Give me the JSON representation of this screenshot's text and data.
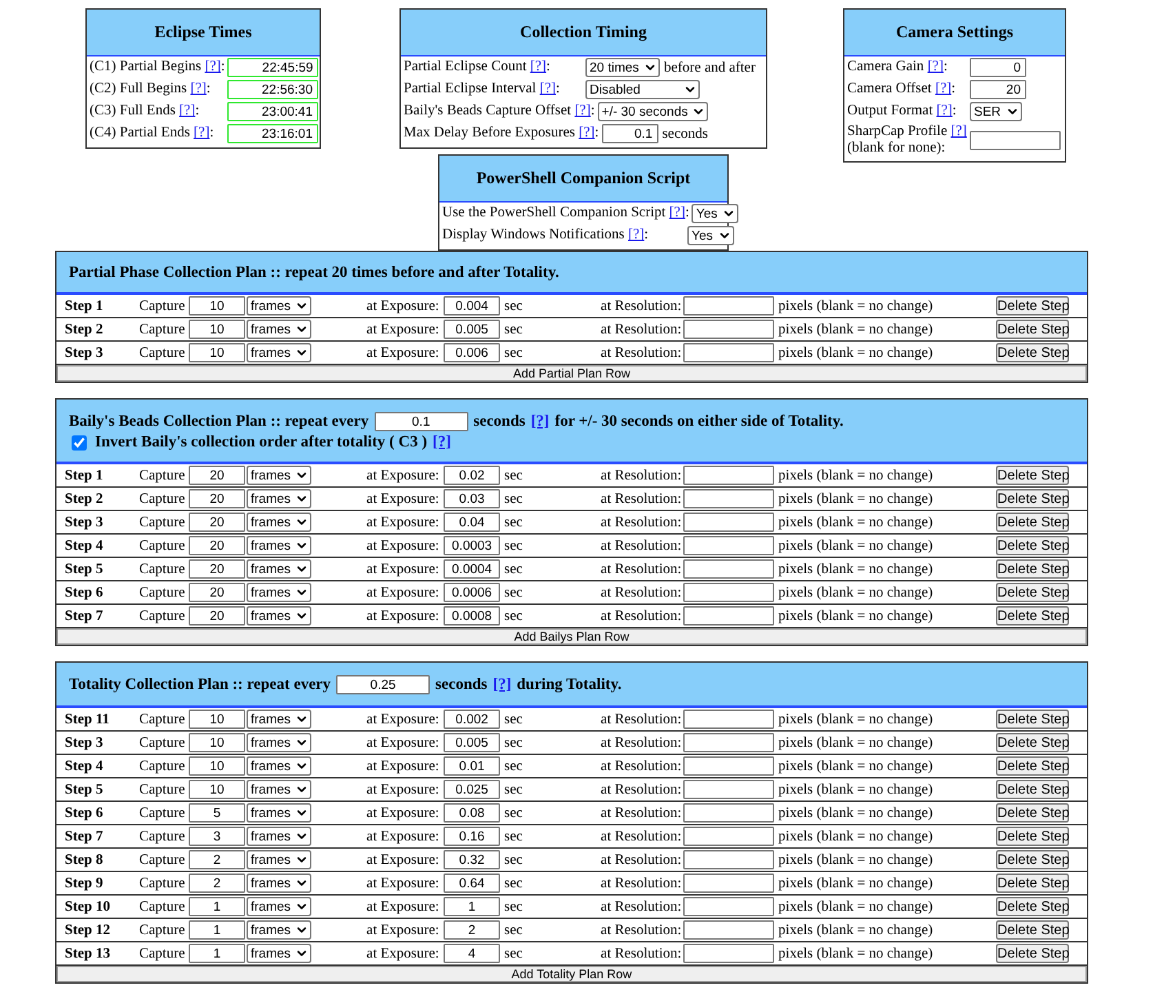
{
  "eclipse_times": {
    "title": "Eclipse Times",
    "rows": [
      {
        "kind": "time",
        "label": "(C1) Partial Begins",
        "help": "[?]",
        "tail": ":",
        "value": "22:45:59"
      },
      {
        "kind": "time",
        "label": "(C2) Full Begins",
        "help": "[?]",
        "tail": ":",
        "value": "22:56:30"
      },
      {
        "kind": "time",
        "label": "(C3) Full Ends",
        "help": "[?]",
        "tail": ":",
        "value": "23:00:41"
      },
      {
        "kind": "time",
        "label": "(C4) Partial Ends",
        "help": "[?]",
        "tail": ":",
        "value": "23:16:01"
      }
    ]
  },
  "collection_timing": {
    "title": "Collection Timing",
    "rows": [
      {
        "kind": "select",
        "label": "Partial Eclipse Count",
        "help": "[?]",
        "tail": ":",
        "value": "20 times",
        "suffix": "before and after"
      },
      {
        "kind": "select",
        "label": "Partial Eclipse Interval",
        "help": "[?]",
        "tail": ":",
        "value": "Disabled"
      },
      {
        "kind": "select",
        "label": "Baily's Beads Capture Offset",
        "help": "[?]",
        "tail": ":",
        "value": "+/- 30 seconds"
      },
      {
        "kind": "input",
        "label": "Max Delay Before Exposures",
        "help": "[?]",
        "tail": ":",
        "value": "0.1",
        "suffix": "seconds"
      }
    ]
  },
  "powershell": {
    "title": "PowerShell Companion Script",
    "rows": [
      {
        "kind": "select",
        "label": "Use the PowerShell Companion Script",
        "help": "[?]",
        "tail": ":",
        "value": "Yes"
      },
      {
        "kind": "select",
        "label": "Display Windows Notifications",
        "help": "[?]",
        "tail": ":",
        "value": "Yes"
      }
    ]
  },
  "camera_settings": {
    "title": "Camera Settings",
    "rows": [
      {
        "kind": "input",
        "label": "Camera Gain",
        "help": "[?]",
        "tail": ":",
        "value": "0"
      },
      {
        "kind": "input",
        "label": "Camera Offset",
        "help": "[?]",
        "tail": ":",
        "value": "20"
      },
      {
        "kind": "select",
        "label": "Output Format",
        "help": "[?]",
        "tail": ":",
        "value": "SER"
      },
      {
        "kind": "input",
        "label": "SharpCap Profile",
        "help": "[?]",
        "note": "(blank for none):"
      }
    ]
  },
  "plans": [
    {
      "header": [
        {
          "kind": "text",
          "text": "Partial Phase Collection Plan :: repeat 20 times before and after Totality."
        }
      ],
      "rows": [
        {
          "step": "Step 1",
          "capture": "Capture",
          "count": "10",
          "unit": "frames",
          "exposure_label": "at Exposure:",
          "exposure": "0.004",
          "sec": "sec",
          "resolution_label": "at Resolution:",
          "note": "pixels (blank = no change)",
          "delete": "Delete Step"
        },
        {
          "step": "Step 2",
          "capture": "Capture",
          "count": "10",
          "unit": "frames",
          "exposure_label": "at Exposure:",
          "exposure": "0.005",
          "sec": "sec",
          "resolution_label": "at Resolution:",
          "note": "pixels (blank = no change)",
          "delete": "Delete Step"
        },
        {
          "step": "Step 3",
          "capture": "Capture",
          "count": "10",
          "unit": "frames",
          "exposure_label": "at Exposure:",
          "exposure": "0.006",
          "sec": "sec",
          "resolution_label": "at Resolution:",
          "note": "pixels (blank = no change)",
          "delete": "Delete Step"
        }
      ],
      "add_button": "Add Partial Plan Row"
    },
    {
      "header": [
        {
          "kind": "text",
          "text": "Baily's Beads Collection Plan :: repeat every"
        },
        {
          "kind": "input",
          "value": "0.1"
        },
        {
          "kind": "text",
          "text": "seconds"
        },
        {
          "kind": "help",
          "text": "[?]"
        },
        {
          "kind": "text",
          "text": "for +/- 30 seconds on either side of Totality."
        }
      ],
      "option": {
        "checked": true,
        "label": "Invert Baily's collection order after totality ( C3 )",
        "help": "[?]"
      },
      "rows": [
        {
          "step": "Step 1",
          "capture": "Capture",
          "count": "20",
          "unit": "frames",
          "exposure_label": "at Exposure:",
          "exposure": "0.02",
          "sec": "sec",
          "resolution_label": "at Resolution:",
          "note": "pixels (blank = no change)",
          "delete": "Delete Step"
        },
        {
          "step": "Step 2",
          "capture": "Capture",
          "count": "20",
          "unit": "frames",
          "exposure_label": "at Exposure:",
          "exposure": "0.03",
          "sec": "sec",
          "resolution_label": "at Resolution:",
          "note": "pixels (blank = no change)",
          "delete": "Delete Step"
        },
        {
          "step": "Step 3",
          "capture": "Capture",
          "count": "20",
          "unit": "frames",
          "exposure_label": "at Exposure:",
          "exposure": "0.04",
          "sec": "sec",
          "resolution_label": "at Resolution:",
          "note": "pixels (blank = no change)",
          "delete": "Delete Step"
        },
        {
          "step": "Step 4",
          "capture": "Capture",
          "count": "20",
          "unit": "frames",
          "exposure_label": "at Exposure:",
          "exposure": "0.0003",
          "sec": "sec",
          "resolution_label": "at Resolution:",
          "note": "pixels (blank = no change)",
          "delete": "Delete Step"
        },
        {
          "step": "Step 5",
          "capture": "Capture",
          "count": "20",
          "unit": "frames",
          "exposure_label": "at Exposure:",
          "exposure": "0.0004",
          "sec": "sec",
          "resolution_label": "at Resolution:",
          "note": "pixels (blank = no change)",
          "delete": "Delete Step"
        },
        {
          "step": "Step 6",
          "capture": "Capture",
          "count": "20",
          "unit": "frames",
          "exposure_label": "at Exposure:",
          "exposure": "0.0006",
          "sec": "sec",
          "resolution_label": "at Resolution:",
          "note": "pixels (blank = no change)",
          "delete": "Delete Step"
        },
        {
          "step": "Step 7",
          "capture": "Capture",
          "count": "20",
          "unit": "frames",
          "exposure_label": "at Exposure:",
          "exposure": "0.0008",
          "sec": "sec",
          "resolution_label": "at Resolution:",
          "note": "pixels (blank = no change)",
          "delete": "Delete Step"
        }
      ],
      "add_button": "Add Bailys Plan Row"
    },
    {
      "header": [
        {
          "kind": "text",
          "text": "Totality Collection Plan :: repeat every"
        },
        {
          "kind": "input",
          "value": "0.25"
        },
        {
          "kind": "text",
          "text": "seconds"
        },
        {
          "kind": "help",
          "text": "[?]"
        },
        {
          "kind": "text",
          "text": "during Totality."
        }
      ],
      "rows": [
        {
          "step": "Step 11",
          "capture": "Capture",
          "count": "10",
          "unit": "frames",
          "exposure_label": "at Exposure:",
          "exposure": "0.002",
          "sec": "sec",
          "resolution_label": "at Resolution:",
          "note": "pixels (blank = no change)",
          "delete": "Delete Step"
        },
        {
          "step": "Step 3",
          "capture": "Capture",
          "count": "10",
          "unit": "frames",
          "exposure_label": "at Exposure:",
          "exposure": "0.005",
          "sec": "sec",
          "resolution_label": "at Resolution:",
          "note": "pixels (blank = no change)",
          "delete": "Delete Step"
        },
        {
          "step": "Step 4",
          "capture": "Capture",
          "count": "10",
          "unit": "frames",
          "exposure_label": "at Exposure:",
          "exposure": "0.01",
          "sec": "sec",
          "resolution_label": "at Resolution:",
          "note": "pixels (blank = no change)",
          "delete": "Delete Step"
        },
        {
          "step": "Step 5",
          "capture": "Capture",
          "count": "10",
          "unit": "frames",
          "exposure_label": "at Exposure:",
          "exposure": "0.025",
          "sec": "sec",
          "resolution_label": "at Resolution:",
          "note": "pixels (blank = no change)",
          "delete": "Delete Step"
        },
        {
          "step": "Step 6",
          "capture": "Capture",
          "count": "5",
          "unit": "frames",
          "exposure_label": "at Exposure:",
          "exposure": "0.08",
          "sec": "sec",
          "resolution_label": "at Resolution:",
          "note": "pixels (blank = no change)",
          "delete": "Delete Step"
        },
        {
          "step": "Step 7",
          "capture": "Capture",
          "count": "3",
          "unit": "frames",
          "exposure_label": "at Exposure:",
          "exposure": "0.16",
          "sec": "sec",
          "resolution_label": "at Resolution:",
          "note": "pixels (blank = no change)",
          "delete": "Delete Step"
        },
        {
          "step": "Step 8",
          "capture": "Capture",
          "count": "2",
          "unit": "frames",
          "exposure_label": "at Exposure:",
          "exposure": "0.32",
          "sec": "sec",
          "resolution_label": "at Resolution:",
          "note": "pixels (blank = no change)",
          "delete": "Delete Step"
        },
        {
          "step": "Step 9",
          "capture": "Capture",
          "count": "2",
          "unit": "frames",
          "exposure_label": "at Exposure:",
          "exposure": "0.64",
          "sec": "sec",
          "resolution_label": "at Resolution:",
          "note": "pixels (blank = no change)",
          "delete": "Delete Step"
        },
        {
          "step": "Step 10",
          "capture": "Capture",
          "count": "1",
          "unit": "frames",
          "exposure_label": "at Exposure:",
          "exposure": "1",
          "sec": "sec",
          "resolution_label": "at Resolution:",
          "note": "pixels (blank = no change)",
          "delete": "Delete Step"
        },
        {
          "step": "Step 12",
          "capture": "Capture",
          "count": "1",
          "unit": "frames",
          "exposure_label": "at Exposure:",
          "exposure": "2",
          "sec": "sec",
          "resolution_label": "at Resolution:",
          "note": "pixels (blank = no change)",
          "delete": "Delete Step"
        },
        {
          "step": "Step 13",
          "capture": "Capture",
          "count": "1",
          "unit": "frames",
          "exposure_label": "at Exposure:",
          "exposure": "4",
          "sec": "sec",
          "resolution_label": "at Resolution:",
          "note": "pixels (blank = no change)",
          "delete": "Delete Step"
        }
      ],
      "add_button": "Add Totality Plan Row"
    }
  ]
}
